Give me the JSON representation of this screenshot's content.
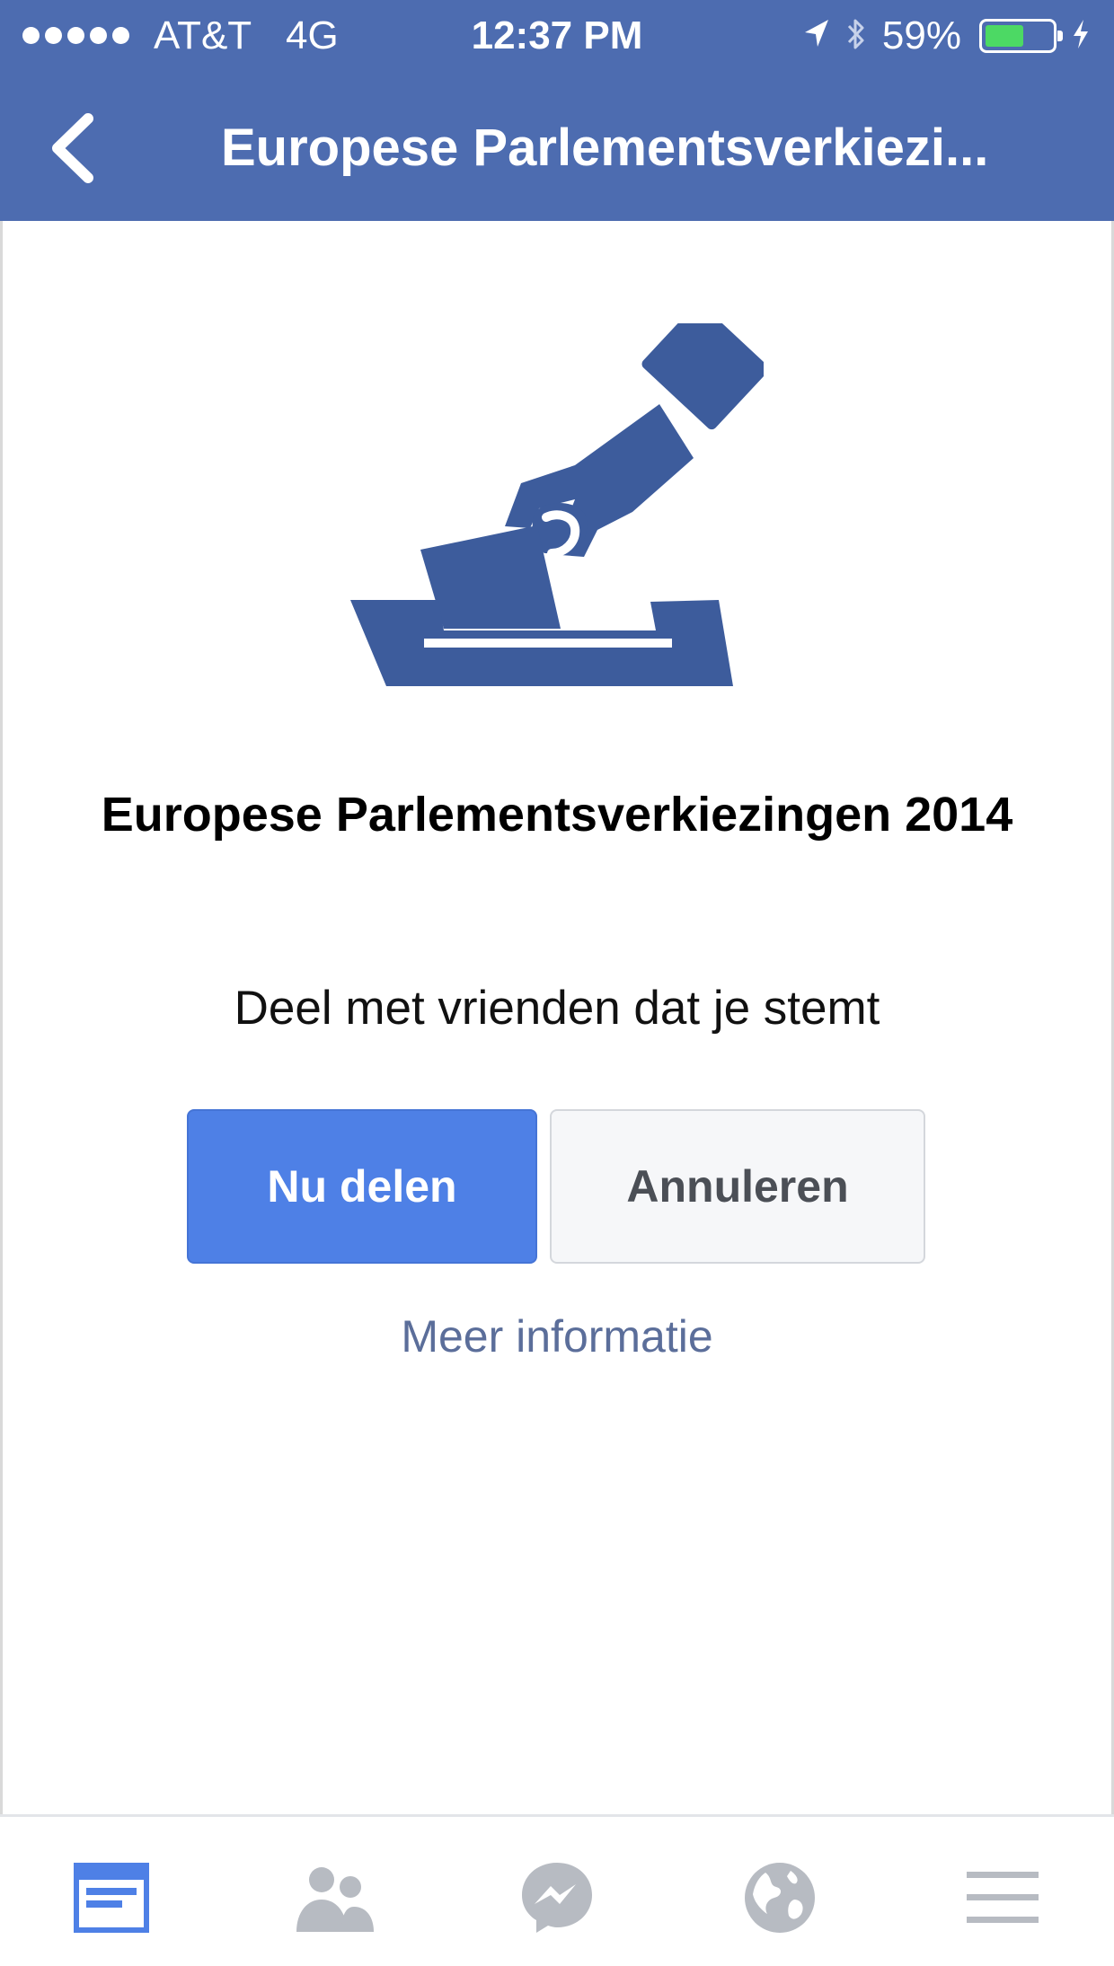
{
  "status_bar": {
    "carrier": "AT&T",
    "network": "4G",
    "time": "12:37 PM",
    "battery_percent": "59%",
    "battery_level": 0.59,
    "icons": [
      "signal-dots-icon",
      "location-arrow-icon",
      "bluetooth-icon",
      "battery-icon",
      "charging-bolt-icon"
    ]
  },
  "header": {
    "title": "Europese Parlementsverkiezi...",
    "back_icon": "chevron-left-icon"
  },
  "main": {
    "illustration": "ballot-box-icon",
    "event_title": "Europese Parlementsverkiezingen 2014",
    "prompt": "Deel met vrienden dat je stemt",
    "share_button": "Nu delen",
    "cancel_button": "Annuleren",
    "more_info_link": "Meer informatie"
  },
  "tab_bar": {
    "tabs": [
      {
        "icon": "news-feed-icon",
        "active": true
      },
      {
        "icon": "friends-icon",
        "active": false
      },
      {
        "icon": "messenger-icon",
        "active": false
      },
      {
        "icon": "globe-icon",
        "active": false
      },
      {
        "icon": "menu-icon",
        "active": false
      }
    ]
  },
  "colors": {
    "header_blue": "#4d6cb0",
    "illustration_blue": "#3d5c9c",
    "primary_button": "#4e80e6",
    "link_text": "#5b6e9a",
    "active_tab": "#4e80e6",
    "inactive_tab": "#b7bbc2",
    "battery_green": "#4cd964"
  }
}
